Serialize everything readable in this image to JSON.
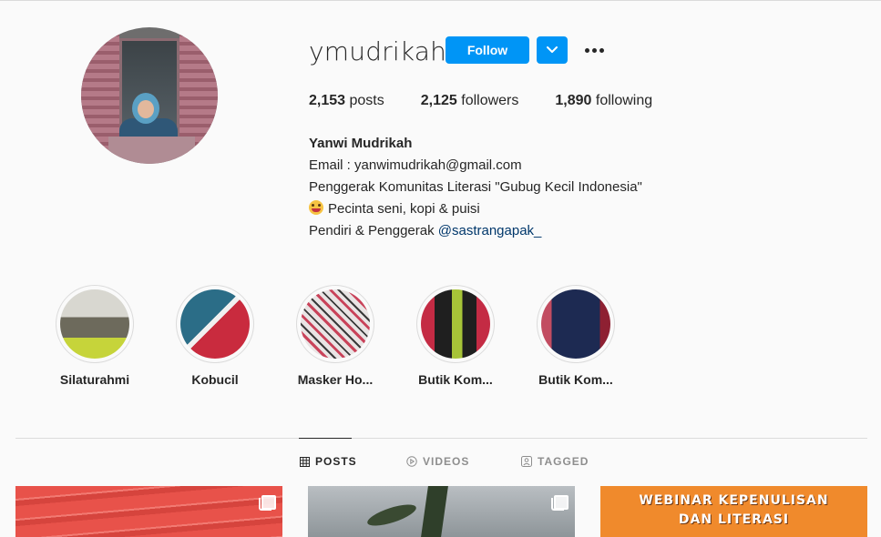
{
  "profile": {
    "username": "ymudrikah",
    "follow_label": "Follow",
    "stats": {
      "posts_count": "2,153",
      "posts_label": "posts",
      "followers_count": "2,125",
      "followers_label": "followers",
      "following_count": "1,890",
      "following_label": "following"
    },
    "bio": {
      "name": "Yanwi Mudrikah",
      "line1": "Email : yanwimudrikah@gmail.com",
      "line2": "Penggerak Komunitas Literasi \"Gubug Kecil Indonesia\"",
      "line3": "Pecinta seni, kopi & puisi",
      "line4_prefix": "Pendiri & Penggerak ",
      "line4_mention": "@sastrangapak_"
    },
    "colors": {
      "accent": "#0095f6",
      "link": "#00376b",
      "text": "#262626",
      "muted": "#8e8e8e"
    }
  },
  "highlights": [
    {
      "label": "Silaturahmi"
    },
    {
      "label": "Kobucil"
    },
    {
      "label": "Masker Ho..."
    },
    {
      "label": "Butik Kom..."
    },
    {
      "label": "Butik Kom..."
    }
  ],
  "tabs": [
    {
      "label": "POSTS",
      "icon": "grid-icon",
      "active": true
    },
    {
      "label": "VIDEOS",
      "icon": "play-icon",
      "active": false
    },
    {
      "label": "TAGGED",
      "icon": "tag-icon",
      "active": false
    }
  ],
  "posts": [
    {
      "icon": "carousel-icon"
    },
    {
      "icon": "carousel-icon"
    },
    {
      "banner_line1": "WEBINAR KEPENULISAN",
      "banner_line2": "DAN LITERASI"
    }
  ]
}
